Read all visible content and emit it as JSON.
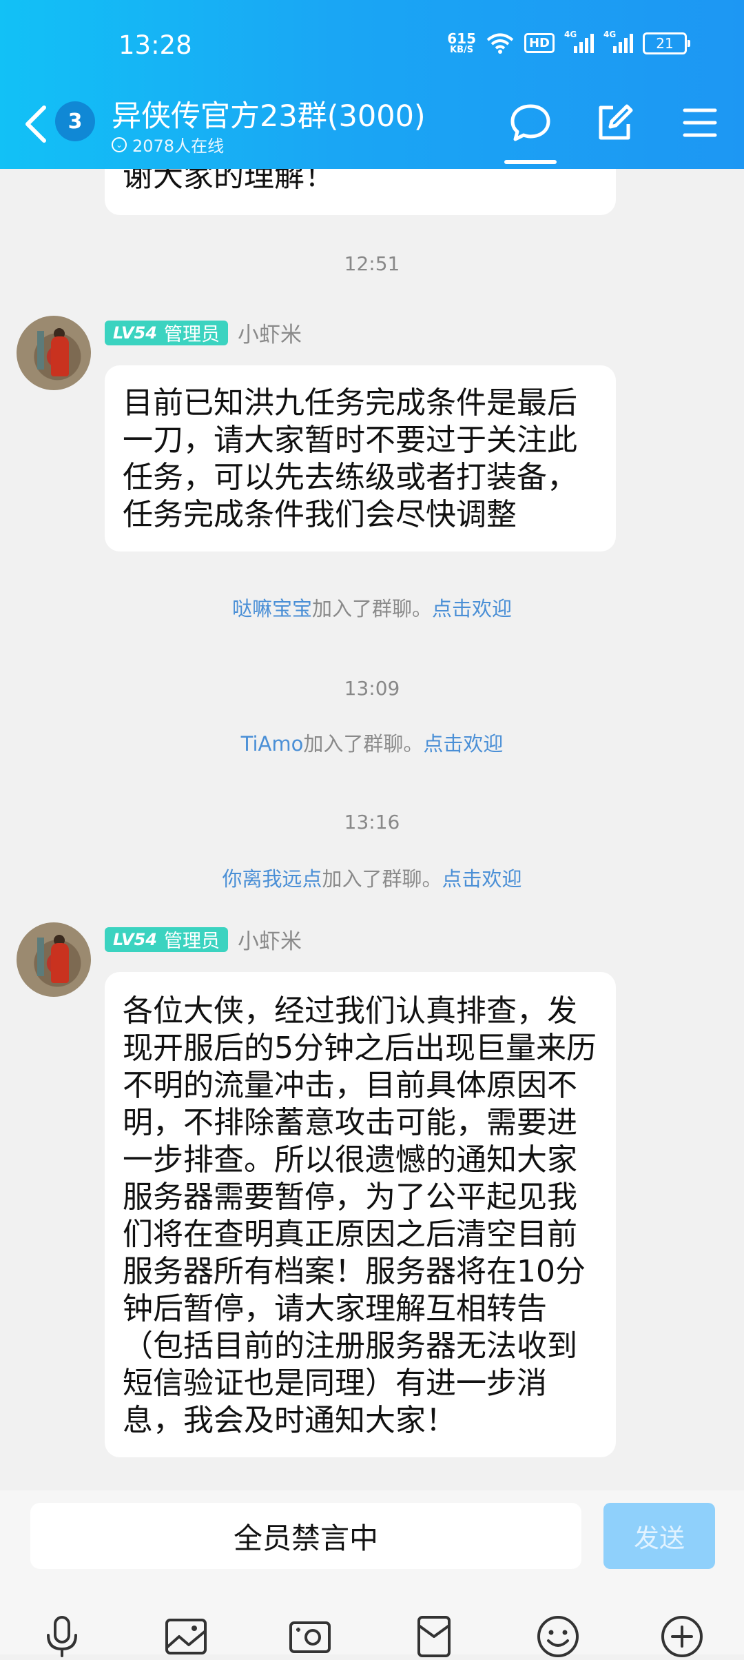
{
  "status_bar": {
    "time": "13:28",
    "net_speed_value": "615",
    "net_speed_unit": "KB/S",
    "hd_label": "HD",
    "signal1_label": "4G",
    "signal2_label": "4G",
    "battery_level": "21"
  },
  "header": {
    "unread_count": "3",
    "group_title": "异侠传官方23群(3000)",
    "online_count": "2078人在线",
    "icons": [
      "back-icon",
      "chat-bubble-icon",
      "edit-icon",
      "menu-icon"
    ]
  },
  "chat": {
    "partial_message": "谢大家的理解！",
    "times": [
      "12:51",
      "13:09",
      "13:16"
    ],
    "messages": [
      {
        "level": "LV54",
        "role": "管理员",
        "sender": "小虾米",
        "text": "目前已知洪九任务完成条件是最后一刀，请大家暂时不要过于关注此任务，可以先去练级或者打装备，任务完成条件我们会尽快调整"
      },
      {
        "level": "LV54",
        "role": "管理员",
        "sender": "小虾米",
        "text": "各位大侠，经过我们认真排查，发现开服后的5分钟之后出现巨量来历不明的流量冲击，目前具体原因不明，不排除蓄意攻击可能，需要进一步排查。所以很遗憾的通知大家服务器需要暂停，为了公平起见我们将在查明真正原因之后清空目前服务器所有档案！服务器将在10分钟后暂停，请大家理解互相转告（包括目前的注册服务器无法收到短信验证也是同理）有进一步消息，我会及时通知大家！"
      }
    ],
    "joins": [
      {
        "name": "哒嘛宝宝",
        "suffix": "加入了群聊。",
        "action": "点击欢迎"
      },
      {
        "name": "TiAmo",
        "suffix": "加入了群聊。",
        "action": "点击欢迎"
      },
      {
        "name": "你离我远点",
        "suffix": "加入了群聊。",
        "action": "点击欢迎"
      }
    ]
  },
  "input": {
    "muted_text": "全员禁言中",
    "send_label": "发送",
    "toolbar_icons": [
      "microphone-icon",
      "image-icon",
      "camera-icon",
      "red-packet-icon",
      "emoji-icon",
      "plus-icon"
    ]
  },
  "colors": {
    "header_start": "#12c1f6",
    "header_end": "#1d97f3",
    "admin_badge": "#3bd3c0",
    "link_blue": "#4a8fd6",
    "send_button": "#8fd0fb"
  }
}
